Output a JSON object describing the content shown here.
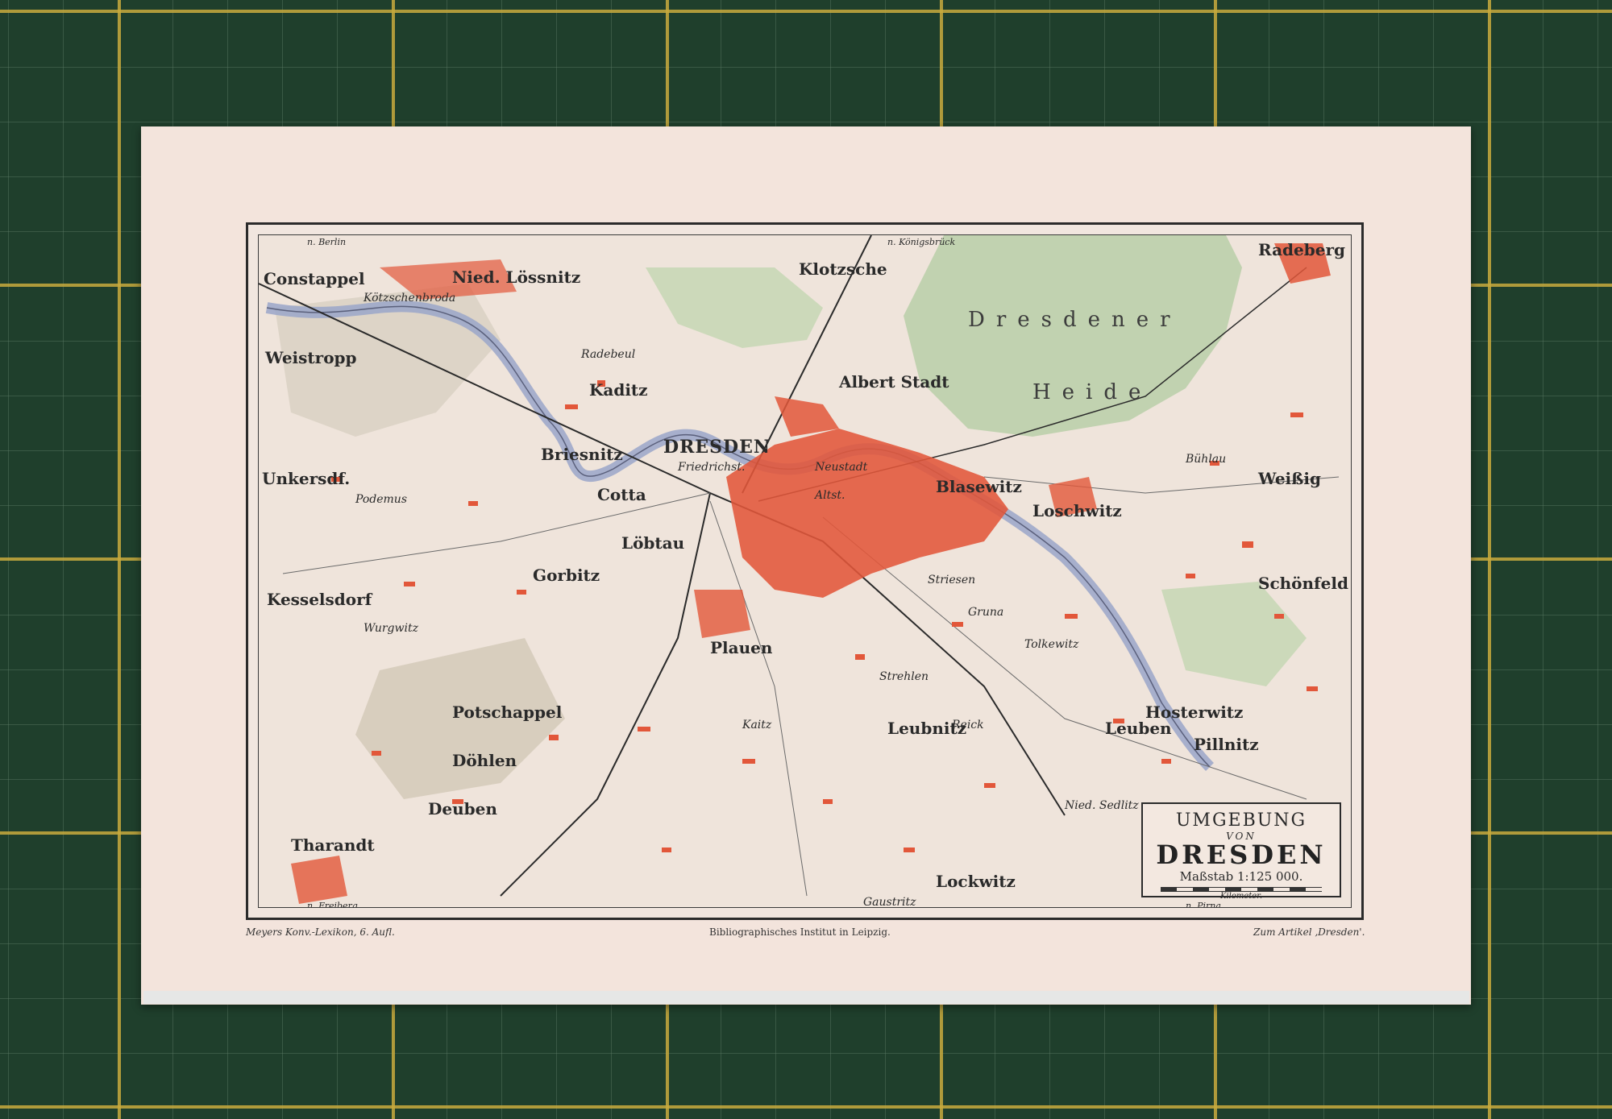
{
  "map": {
    "title_line1": "UMGEBUNG",
    "title_line2": "VON",
    "title_line3": "DRESDEN",
    "scale_text": "Maßstab 1:125 000.",
    "scale_unit": "Kilometer.",
    "footer_left": "Meyers Konv.-Lexikon, 6. Aufl.",
    "footer_center": "Bibliographisches Institut in Leipzig.",
    "footer_right": "Zum Artikel ‚Dresden'.",
    "labels": {
      "dresden": "DRESDEN",
      "radeberg": "Radeberg",
      "forest1": "Dresdener",
      "forest2": "Heide",
      "constappel": "Constappel",
      "koetzschenbroda": "Kötzschenbroda",
      "niedloessnitz": "Nied. Lössnitz",
      "weistropp": "Weistropp",
      "radebeul": "Radebeul",
      "kaditz": "Kaditz",
      "klotzsche": "Klotzsche",
      "albertstadt": "Albert Stadt",
      "neustadt": "Neustadt",
      "altstadt": "Altst.",
      "friedrichstadt": "Friedrichst.",
      "blasewitz": "Blasewitz",
      "loschwitz": "Loschwitz",
      "weissig": "Weißig",
      "buehlau": "Bühlau",
      "loebtau": "Löbtau",
      "plauen": "Plauen",
      "unkersdf": "Unkersdf.",
      "kesselsdorf": "Kesselsdorf",
      "potschappel": "Potschappel",
      "doehlen": "Döhlen",
      "deuben": "Deuben",
      "tharandt": "Tharandt",
      "leuben": "Leuben",
      "pillnitz": "Pillnitz",
      "lockwitz": "Lockwitz",
      "strehlen": "Strehlen",
      "gruna": "Gruna",
      "striesen": "Striesen",
      "leubnitz": "Leubnitz",
      "schoenfeld": "Schönfeld",
      "niedsedlitz": "Nied. Sedlitz",
      "gaustritz": "Gaustritz",
      "cotta": "Cotta",
      "briesnitz": "Briesnitz",
      "gorbitz": "Gorbitz",
      "hosterwitz": "Hosterwitz",
      "kaitz": "Kaitz",
      "reick": "Reick",
      "tolkewitz": "Tolkewitz",
      "gruna2": "Gruna",
      "podemus": "Podemus",
      "wurgwitz": "Wurgwitz",
      "grossenhain": "n. Königsbrück",
      "pirna": "n. Pirna",
      "freiberg": "n. Freiberg",
      "berlin": "n. Berlin"
    }
  }
}
